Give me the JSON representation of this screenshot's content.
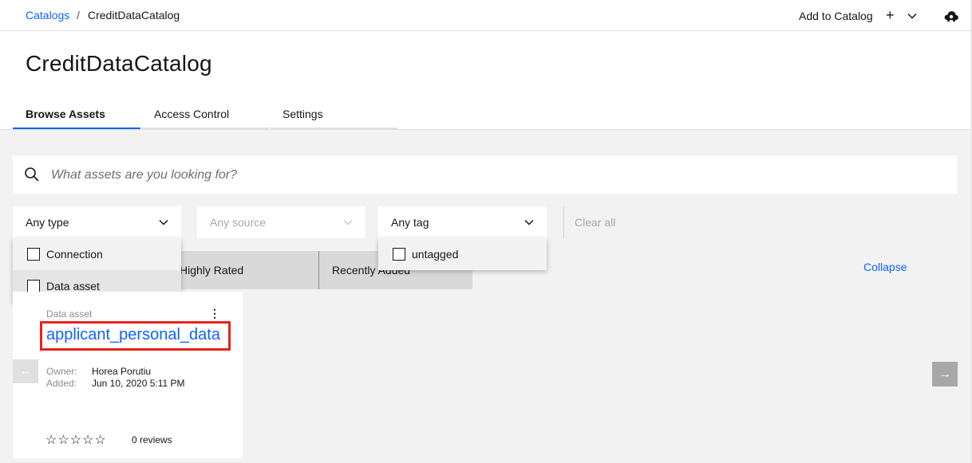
{
  "breadcrumb": {
    "root": "Catalogs",
    "separator": "/",
    "current": "CreditDataCatalog"
  },
  "header": {
    "add_to_catalog": "Add to Catalog",
    "plus": "+"
  },
  "page_title": "CreditDataCatalog",
  "tabs": [
    {
      "label": "Browse Assets",
      "active": true
    },
    {
      "label": "Access Control",
      "active": false
    },
    {
      "label": "Settings",
      "active": false
    }
  ],
  "search": {
    "placeholder": "What assets are you looking for?"
  },
  "filters": {
    "type": "Any type",
    "source": "Any source",
    "tag": "Any tag",
    "clear_all": "Clear all"
  },
  "type_menu": [
    "Connection",
    "Data asset"
  ],
  "tag_menu": [
    "untagged"
  ],
  "sort": {
    "highly_rated": "Highly Rated",
    "recently_added": "Recently Added"
  },
  "collapse": "Collapse",
  "card": {
    "type": "Data asset",
    "menu": "⋮",
    "title": "applicant_personal_data",
    "owner_label": "Owner:",
    "owner": "Horea Porutiu",
    "added_label": "Added:",
    "added": "Jun 10, 2020 5:11 PM",
    "stars": "☆☆☆☆☆",
    "reviews": "0 reviews"
  },
  "nav": {
    "prev": "←",
    "next": "→"
  },
  "colors": {
    "accent": "#0f62fe",
    "highlight_box": "#e8221a",
    "background": "#f2f2f2"
  }
}
